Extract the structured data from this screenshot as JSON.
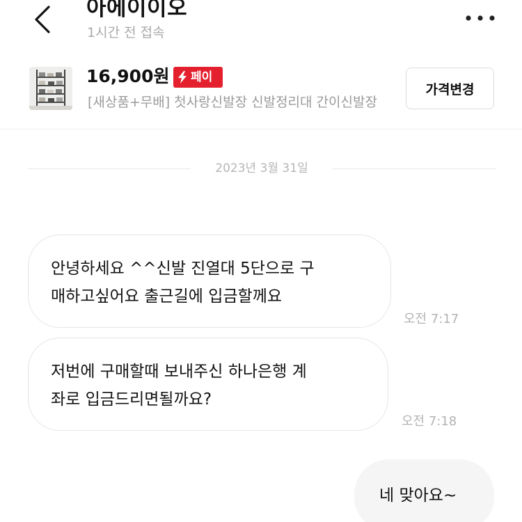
{
  "header": {
    "title": "아에이이오",
    "subtitle": "1시간 전 접속",
    "back_icon": "chevron-left-icon",
    "more_icon": "more-horizontal-icon"
  },
  "product": {
    "price": "16,900원",
    "pay_badge": "페이",
    "pay_icon": "lightning-bolt-icon",
    "name": "[새상품+무배] 첫사랑신발장 신발정리대  간이신발장",
    "price_change_button": "가격변경"
  },
  "chat": {
    "date": "2023년 3월 31일",
    "messages": [
      {
        "sender": "other",
        "lines": [
          "안녕하세요 ^^신발 진열대 5단으로 구",
          "매하고싶어요 출근길에 입금할께요"
        ],
        "time": "오전 7:17"
      },
      {
        "sender": "other",
        "lines": [
          "저번에 구매할때 보내주신 하나은행 계",
          "좌로 입금드리면될까요?"
        ],
        "time": "오전 7:18"
      },
      {
        "sender": "me",
        "lines": [
          "네 맞아요~"
        ]
      }
    ]
  },
  "colors": {
    "pay_badge": "#e5202e",
    "bubble_border": "#e5e5e5",
    "my_bubble": "#f5f5f5",
    "muted_text": "#a9a9a9"
  }
}
